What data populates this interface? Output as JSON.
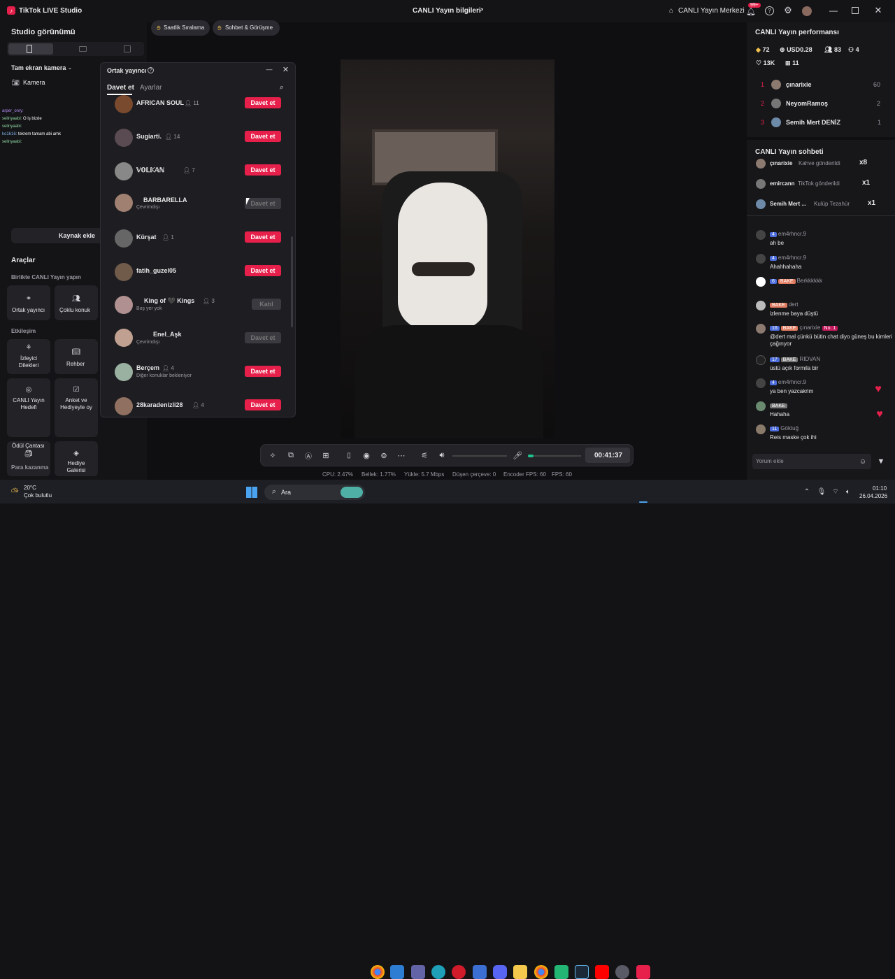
{
  "app": {
    "title": "TikTok LIVE Studio",
    "center_title": "CANLI Yayın bilgileri",
    "center_link": "CANLI Yayın Merkezi",
    "notif_badge": "99+"
  },
  "left": {
    "studio_view": "Studio görünümü",
    "scene": "Tam ekran kamera",
    "camera": "Kamera",
    "add_source": "Kaynak ekle",
    "tools_title": "Araçlar",
    "collab_title": "Birlikte CANLI Yayın yapın",
    "tools1": [
      "Ortak yayıncı",
      "Çoklu konuk"
    ],
    "engage_title": "Etkileşim",
    "tools2": [
      "İzleyici Dilekleri",
      "Rehber"
    ],
    "tools3": [
      "CANLI Yayın Hedefi",
      "Anket ve Hediyeyle oy"
    ],
    "tools4": [
      "Ödül Çantası",
      "Hediye Galerisi"
    ],
    "earn_title": "Para kazanma",
    "overlay_chat": [
      {
        "user": "arper_onry:",
        "msg": ""
      },
      {
        "user": "selinyaabi:",
        "msg": "O iş bizde"
      },
      {
        "user": "selinyaabi:",
        "msg": ""
      },
      {
        "user": "ko1616:",
        "msg": "tekrem tamam abi amk"
      },
      {
        "user": "selinyaabi:",
        "msg": ""
      }
    ]
  },
  "stage": {
    "chips": [
      "Saatlik Sıralama",
      "Sohbet & Görüşme"
    ]
  },
  "dialog": {
    "title": "Ortak yayıncı",
    "tabs": [
      "Davet et",
      "Ayarlar"
    ],
    "rows": [
      {
        "name": "AFRICAN SOUL",
        "count": "11",
        "status": "",
        "button": "Davet et",
        "enabled": true
      },
      {
        "name": "Sugiarti.",
        "count": "14",
        "status": "",
        "button": "Davet et",
        "enabled": true
      },
      {
        "name": "𝕍𝕆𝕃𝕂𝔸ℕ",
        "count": "7",
        "status": "",
        "button": "Davet et",
        "enabled": true
      },
      {
        "name": "BARBARELLA",
        "count": "",
        "status": "Çevrimdışı",
        "button": "Davet et",
        "enabled": false
      },
      {
        "name": "Kürşat",
        "count": "1",
        "status": "",
        "button": "Davet et",
        "enabled": true
      },
      {
        "name": "fatih_guzel05",
        "count": "",
        "status": "",
        "button": "Davet et",
        "enabled": true
      },
      {
        "name": "King of 🖤 Kings",
        "count": "3",
        "status": "Boş yer yok",
        "button": "Katıl",
        "enabled": false
      },
      {
        "name": "Enel_Aşk",
        "count": "",
        "status": "Çevrimdışı",
        "button": "Davet et",
        "enabled": false
      },
      {
        "name": "Berçem",
        "count": "4",
        "status": "Diğer konuklar bekleniyor",
        "button": "Davet et",
        "enabled": true
      },
      {
        "name": "28karadenizli28",
        "count": "4",
        "status": "",
        "button": "Davet et",
        "enabled": true
      }
    ]
  },
  "controls": {
    "timer": "00:41:37"
  },
  "stats": {
    "cpu": "CPU: 2.47%",
    "mem": "Bellek: 1.77%",
    "load": "Yükle: 5.7 Mbps",
    "drop": "Düşen çerçeve: 0",
    "enc": "Encoder FPS: 60",
    "fps": "FPS: 60"
  },
  "right": {
    "perf_title": "CANLI Yayın performansı",
    "perf": {
      "diamonds": "72",
      "usd": "USD0.28",
      "viewers": "83",
      "users": "4",
      "likes": "13K",
      "gifts": "11"
    },
    "ranking": [
      {
        "rank": "1",
        "name": "çınarixie",
        "score": "60"
      },
      {
        "rank": "2",
        "name": "NeyomRamoş",
        "score": "2"
      },
      {
        "rank": "3",
        "name": "Semih Mert DENİZ",
        "score": "1"
      }
    ],
    "chat_title": "CANLI Yayın sohbeti",
    "gifts": [
      {
        "user": "çınarixie",
        "text": "Kahve gönderildi",
        "mult": "x8"
      },
      {
        "user": "emircann",
        "text": "TikTok gönderildi",
        "mult": "x1"
      },
      {
        "user": "Semih Mert ...",
        "text": "Kulüp Tezahür",
        "mult": "x1"
      }
    ],
    "messages": [
      {
        "level": "4",
        "tag": "",
        "user": "em4rhncr.9",
        "msg": "ah be"
      },
      {
        "level": "4",
        "tag": "",
        "user": "em4rhncr.9",
        "msg": "Ahahhahaha"
      },
      {
        "level": "6",
        "tag": "BAKE",
        "user": "Berkkkkkk",
        "msg": ""
      },
      {
        "level": "",
        "tag": "BAKE",
        "user": "dert",
        "msg": "izlenme baya düştü"
      },
      {
        "level": "16",
        "tag": "BAKE",
        "user": "çınarixie",
        "msg": "@dert mal çünkü bütin chat diyo güneş bu kimleri çağırıyor"
      },
      {
        "level": "17",
        "tag": "BAKE",
        "user": "RIDVAN",
        "msg": "üstü açık formila bir"
      },
      {
        "level": "4",
        "tag": "",
        "user": "em4rhncr.9",
        "msg": "ya ben yazcakrim"
      },
      {
        "level": "",
        "tag": "BAKE",
        "user": "",
        "msg": "Hahaha"
      },
      {
        "level": "11",
        "tag": "",
        "user": "Göktuğ",
        "msg": "Reis maske çok ihi"
      }
    ],
    "no1": "No. 1",
    "comment_placeholder": "Yorum ekle"
  },
  "taskbar": {
    "weather_temp": "20°C",
    "weather_desc": "Çok bulutlu",
    "search": "Ara",
    "time": "01:10",
    "date": "26.04.2026"
  },
  "colors": {
    "accent": "#e6204b",
    "bg": "#141417"
  }
}
